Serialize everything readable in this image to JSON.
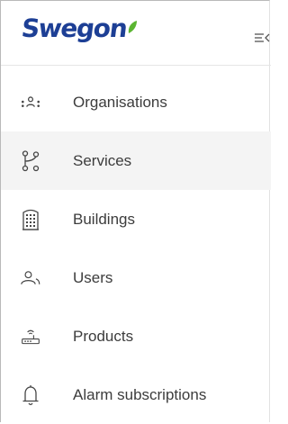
{
  "brand": {
    "name": "Swegon",
    "color": "#1d3f95",
    "leaf_color": "#5bb531"
  },
  "header": {
    "collapse_icon": "menu-collapse-icon"
  },
  "sidebar": {
    "items": [
      {
        "label": "Organisations",
        "icon": "organisations-icon",
        "active": false
      },
      {
        "label": "Services",
        "icon": "services-icon",
        "active": true
      },
      {
        "label": "Buildings",
        "icon": "building-icon",
        "active": false
      },
      {
        "label": "Users",
        "icon": "users-icon",
        "active": false
      },
      {
        "label": "Products",
        "icon": "router-icon",
        "active": false
      },
      {
        "label": "Alarm subscriptions",
        "icon": "bell-icon",
        "active": false
      }
    ]
  },
  "colors": {
    "text": "#3c3c3c",
    "active_background": "#f4f4f4",
    "icon_stroke": "#444444"
  }
}
